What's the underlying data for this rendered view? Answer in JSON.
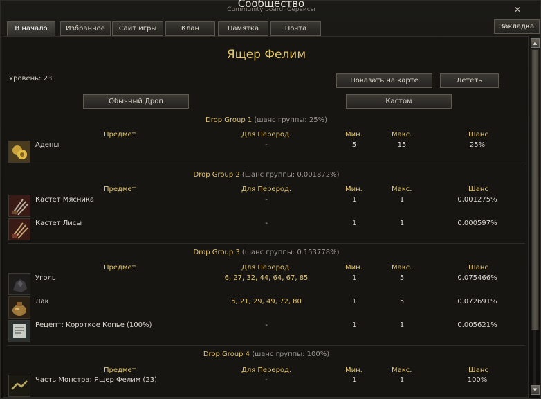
{
  "window": {
    "title": "Сообщество",
    "subtitle": "Community board: Сервисы",
    "close_glyph": "✕"
  },
  "tabs": [
    {
      "label": "В начало",
      "active": true
    },
    {
      "label": "Избранное"
    },
    {
      "label": "Сайт игры"
    },
    {
      "label": "Клан"
    },
    {
      "label": "Памятка"
    },
    {
      "label": "Почта"
    }
  ],
  "bookmark_label": "Закладка",
  "monster_name": "Ящер Фелим",
  "level_text": "Уровень: 23",
  "buttons": {
    "show_on_map": "Показать на карте",
    "fly": "Лететь",
    "normal_drop": "Обычный Дроп",
    "custom": "Кастом"
  },
  "headers": {
    "item": "Предмет",
    "for_craft": "Для Перерод.",
    "min": "Мин.",
    "max": "Макс.",
    "chance": "Шанс"
  },
  "groups": [
    {
      "name": "Drop Group 1",
      "chance": "(шанс группы: 25%)",
      "items": [
        {
          "icon": "adena-coins-icon",
          "name": "Адены",
          "craft": "-",
          "min": "5",
          "max": "15",
          "chance": "25%"
        }
      ]
    },
    {
      "name": "Drop Group 2",
      "chance": "(шанс группы: 0.001872%)",
      "items": [
        {
          "icon": "claw-weapon-icon",
          "name": "Кастет Мясника",
          "craft": "-",
          "min": "1",
          "max": "1",
          "chance": "0.001275%"
        },
        {
          "icon": "claw-weapon-icon",
          "name": "Кастет Лисы",
          "craft": "-",
          "min": "1",
          "max": "1",
          "chance": "0.000597%"
        }
      ]
    },
    {
      "name": "Drop Group 3",
      "chance": "(шанс группы: 0.153778%)",
      "items": [
        {
          "icon": "coal-icon",
          "name": "Уголь",
          "craft": "6, 27, 32, 44, 64, 67, 85",
          "min": "1",
          "max": "5",
          "chance": "0.075466%"
        },
        {
          "icon": "varnish-bag-icon",
          "name": "Лак",
          "craft": "5, 21, 29, 49, 72, 80",
          "min": "1",
          "max": "5",
          "chance": "0.072691%"
        },
        {
          "icon": "recipe-scroll-icon",
          "name": "Рецепт: Короткое Копье (100%)",
          "craft": "-",
          "min": "1",
          "max": "1",
          "chance": "0.005621%"
        }
      ]
    },
    {
      "name": "Drop Group 4",
      "chance": "(шанс группы: 100%)",
      "items": [
        {
          "icon": "monster-part-icon",
          "name": "Часть Монстра: Ящер Фелим (23)",
          "craft": "-",
          "min": "1",
          "max": "1",
          "chance": "100%"
        }
      ]
    }
  ],
  "colors": {
    "accent_gold": "#e2c36a",
    "text": "#dcd8d0",
    "panel_bg": "#161512"
  }
}
